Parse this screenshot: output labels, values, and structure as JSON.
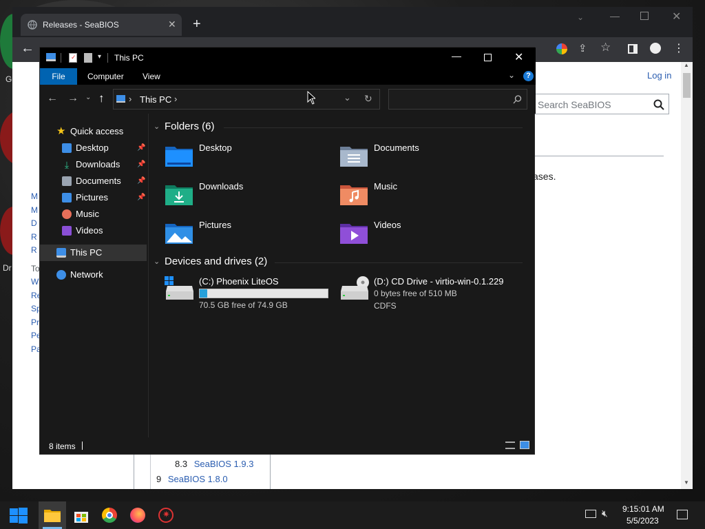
{
  "browser": {
    "tab_title": "Releases - SeaBIOS",
    "new_tab_label": "+",
    "login_link": "Log in",
    "search_placeholder": "Search SeaBIOS",
    "page_fragment_text": "ases.",
    "toc_items": [
      {
        "num": "8.3",
        "label": "SeaBIOS 1.9.3"
      },
      {
        "num": "9",
        "label": "SeaBIOS 1.8.0"
      }
    ],
    "left_fragments": [
      "M",
      "M",
      "D",
      "R",
      "R",
      "To",
      "W",
      "Re",
      "Sp",
      "Pr",
      "Pe",
      "Pa"
    ],
    "desktop_fragments": [
      "G",
      "Dr"
    ]
  },
  "explorer": {
    "title": "This PC",
    "ribbon": {
      "file": "File",
      "computer": "Computer",
      "view": "View",
      "help": "?"
    },
    "address": {
      "path_label": "This PC",
      "separator": "›"
    },
    "search_value": "",
    "nav": [
      {
        "label": "Quick access",
        "icon": "star-icon",
        "color": "#f5c518",
        "pinned": false,
        "indent": 0
      },
      {
        "label": "Desktop",
        "icon": "desktop-folder-icon",
        "color": "#3d8ee6",
        "pinned": true,
        "indent": 1
      },
      {
        "label": "Downloads",
        "icon": "download-icon",
        "color": "#2fbf8f",
        "pinned": true,
        "indent": 1
      },
      {
        "label": "Documents",
        "icon": "document-icon",
        "color": "#9aa4b1",
        "pinned": true,
        "indent": 1
      },
      {
        "label": "Pictures",
        "icon": "picture-icon",
        "color": "#3d8ee6",
        "pinned": true,
        "indent": 1
      },
      {
        "label": "Music",
        "icon": "music-icon",
        "color": "#e86f5a",
        "pinned": false,
        "indent": 1
      },
      {
        "label": "Videos",
        "icon": "video-icon",
        "color": "#8a4fd6",
        "pinned": false,
        "indent": 1
      },
      {
        "label": "This PC",
        "icon": "this-pc-icon",
        "color": "#3d8ee6",
        "pinned": false,
        "indent": 0,
        "selected": true
      },
      {
        "label": "Network",
        "icon": "network-icon",
        "color": "#3d8ee6",
        "pinned": false,
        "indent": 0
      }
    ],
    "folders_header": "Folders (6)",
    "folders": [
      {
        "name": "Desktop",
        "icon": "desktop-folder-icon",
        "color": "#1e90ff"
      },
      {
        "name": "Documents",
        "icon": "documents-folder-icon",
        "color": "#8ea0b8"
      },
      {
        "name": "Downloads",
        "icon": "downloads-folder-icon",
        "color": "#1fae87"
      },
      {
        "name": "Music",
        "icon": "music-folder-icon",
        "color": "#ef7b5b"
      },
      {
        "name": "Pictures",
        "icon": "pictures-folder-icon",
        "color": "#2f8fe6"
      },
      {
        "name": "Videos",
        "icon": "videos-folder-icon",
        "color": "#8f4fd8"
      }
    ],
    "drives_header": "Devices and drives (2)",
    "drives": [
      {
        "name": "(C:) Phoenix LiteOS",
        "free_text": "70.5 GB free of 74.9 GB",
        "used_fraction": 0.059,
        "icon": "windows-drive-icon"
      },
      {
        "name": "(D:) CD Drive - virtio-win-0.1.229",
        "free_text": "0 bytes free of 510 MB",
        "fs": "CDFS",
        "icon": "cd-drive-icon"
      }
    ],
    "status_text": "8 items"
  },
  "taskbar": {
    "time": "9:15:01 AM",
    "date": "5/5/2023"
  }
}
